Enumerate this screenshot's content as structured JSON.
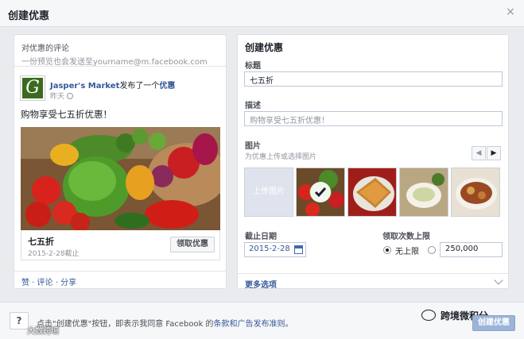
{
  "dialog": {
    "title": "创建优惠",
    "close_icon": "close-icon"
  },
  "preview": {
    "title": "对优惠的评论",
    "subtitle": "一份预览也会发送至yourname@m.facebook.com",
    "post": {
      "logo_letter": "G",
      "page_name": "Jasper's Market",
      "action_text": "发布了一个",
      "deal_link": "优惠",
      "time": "昨天",
      "text": "购物享受七五折优惠！",
      "photo_icon": "vegetables-photo"
    },
    "offer": {
      "name": "七五折",
      "expires": "2015-2-28截止",
      "claim_button": "领取优惠"
    },
    "actions": "赞 · 评论 · 分享"
  },
  "form": {
    "title": "创建优惠",
    "headline_label": "标题",
    "headline_value": "七五折",
    "description_label": "描述",
    "description_placeholder": "购物享受七五折优惠！",
    "photo_label": "图片",
    "photo_hint": "为优惠上传或选择图片",
    "upload_label": "上传图片",
    "thumbnails": [
      "vegetables-thumb",
      "pie-thumb",
      "soup-thumb",
      "stew-thumb"
    ],
    "selected_thumb": 0,
    "expiry_label": "截止日期",
    "expiry_value": "2015-2-28",
    "claims_label": "领取次数上限",
    "unlimited_label": "无上限",
    "claims_value": "250,000",
    "more_options": "更多选项"
  },
  "footer": {
    "terms_prefix": "点击\"创建优惠\"按钮，即表示我同意 Facebook 的",
    "terms_link": "条款和广告发布准则",
    "terms_suffix": "。",
    "watermark_left": "大数跨境",
    "watermark_right": "跨境微积分",
    "create_button": "创建优惠"
  },
  "colors": {
    "link": "#365899",
    "background": "#e9ebee",
    "button_disabled": "#9cb4d8"
  }
}
